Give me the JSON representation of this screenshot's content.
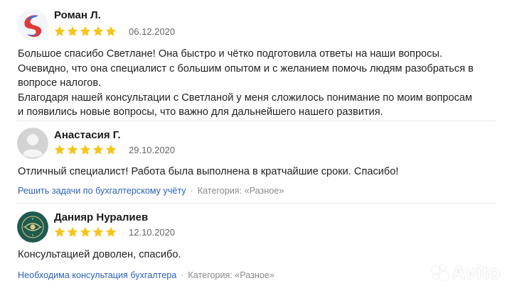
{
  "reviews": [
    {
      "name": "Роман Л.",
      "rating": 5,
      "date": "06.12.2020",
      "avatar": "abstract-logo-avatar",
      "text": [
        "Большое спасибо Светлане! Она быстро и чётко подготовила ответы на наши вопросы.",
        "Очевидно, что она специалист с большим опытом и с желанием помочь людям разобраться в",
        "вопросе налогов.",
        "Благодаря нашей консультации с Светланой у меня сложилось понимание по моим вопросам",
        "и появились новые вопросы, что важно для дальнейшего нашего развития."
      ]
    },
    {
      "name": "Анастасия Г.",
      "rating": 5,
      "date": "29.10.2020",
      "avatar": "default-user-avatar",
      "text": [
        "Отличный специалист! Работа была выполнена в кратчайшие сроки. Спасибо!"
      ],
      "task_link": "Решить задачи по бухгалтерскому учёту",
      "category": "Категория: «Разное»"
    },
    {
      "name": "Данияр Нуралиев",
      "rating": 5,
      "date": "12.10.2020",
      "avatar": "eye-emblem-avatar",
      "text": [
        "Консультацией доволен, спасибо."
      ],
      "task_link": "Необходима консультация бухгалтера",
      "category": "Категория: «Разное»"
    }
  ],
  "separator": "·",
  "watermark": "Avito",
  "colors": {
    "star": "#f5c518",
    "link": "#2b63b6",
    "category": "#8a8a8a",
    "avatar_teal": "#1f5a4f"
  }
}
